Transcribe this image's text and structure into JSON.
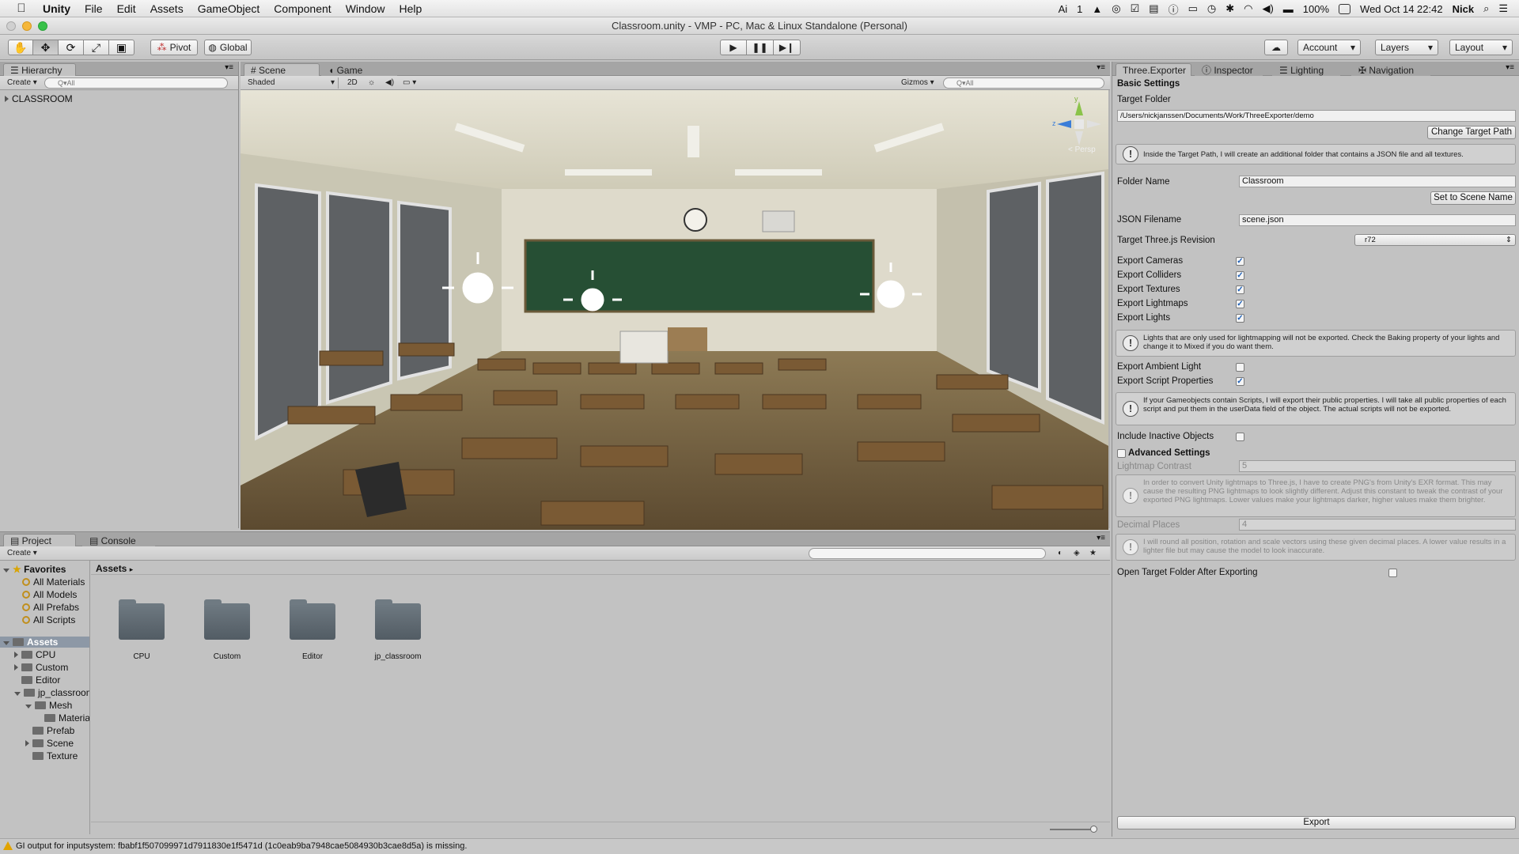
{
  "menubar": {
    "app_name": "Unity",
    "menus": [
      "File",
      "Edit",
      "Assets",
      "GameObject",
      "Component",
      "Window",
      "Help"
    ],
    "status": {
      "battery": "100%",
      "datetime": "Wed Oct 14  22:42",
      "user": "Nick",
      "notification_count": "1"
    }
  },
  "window": {
    "title": "Classroom.unity - VMP - PC, Mac & Linux Standalone (Personal)"
  },
  "toolbar": {
    "pivot_label": "Pivot",
    "global_label": "Global",
    "account_label": "Account",
    "layers_label": "Layers",
    "layout_label": "Layout"
  },
  "hierarchy": {
    "tab_label": "Hierarchy",
    "create_label": "Create",
    "search_placeholder": "Q▾All",
    "items": [
      "CLASSROOM"
    ]
  },
  "scene": {
    "tabs": [
      "Scene",
      "Game"
    ],
    "shading": "Shaded",
    "mode_2d": "2D",
    "gizmos_label": "Gizmos",
    "search_placeholder": "Q▾All",
    "persp_label": "Persp",
    "axis_labels": {
      "y": "y",
      "z": "z"
    }
  },
  "inspector": {
    "tabs": [
      "Three.Exporter",
      "Inspector",
      "Lighting",
      "Navigation"
    ],
    "basic_settings": "Basic Settings",
    "target_folder_label": "Target Folder",
    "target_folder_value": "/Users/nickjanssen/Documents/Work/ThreeExporter/demo",
    "change_target_path": "Change Target Path",
    "info_target_path": "Inside the Target Path, I will create an additional folder that contains a JSON file and all textures.",
    "folder_name_label": "Folder Name",
    "folder_name_value": "Classroom",
    "set_to_scene_name": "Set to Scene Name",
    "json_filename_label": "JSON Filename",
    "json_filename_value": "scene.json",
    "revision_label": "Target Three.js Revision",
    "revision_value": "r72",
    "options": [
      {
        "label": "Export Cameras",
        "checked": true
      },
      {
        "label": "Export Colliders",
        "checked": true
      },
      {
        "label": "Export Textures",
        "checked": true
      },
      {
        "label": "Export Lightmaps",
        "checked": true
      },
      {
        "label": "Export Lights",
        "checked": true
      }
    ],
    "info_lights": "Lights that are only used for lightmapping will not be exported. Check the Baking property of your lights and change it to Mixed if you do want them.",
    "export_ambient_label": "Export Ambient Light",
    "export_ambient_checked": false,
    "export_script_label": "Export Script Properties",
    "export_script_checked": true,
    "info_scripts": "If your Gameobjects contain Scripts, I will export their public properties. I will take all public properties of each script and put them in the userData field of the object. The actual scripts will not be exported.",
    "include_inactive_label": "Include Inactive Objects",
    "include_inactive_checked": false,
    "advanced_settings": "Advanced Settings",
    "lightmap_contrast_label": "Lightmap Contrast",
    "lightmap_contrast_value": "5",
    "info_lightmap": "In order to convert Unity lightmaps to Three.js, I have to create PNG's from Unity's EXR format. This may cause the resulting PNG lightmaps to look slightly different. Adjust this constant to tweak the contrast of your exported PNG lightmaps. Lower values make your lightmaps darker, higher values make them brighter.",
    "decimal_places_label": "Decimal Places",
    "decimal_places_value": "4",
    "info_decimal": "I will round all position, rotation and scale vectors using these given decimal places. A lower value results in a lighter file but may cause the model to look inaccurate.",
    "open_target_label": "Open Target Folder After Exporting",
    "open_target_checked": false,
    "export_button": "Export"
  },
  "project": {
    "tabs": [
      "Project",
      "Console"
    ],
    "create_label": "Create",
    "favorites_label": "Favorites",
    "favorites": [
      "All Materials",
      "All Models",
      "All Prefabs",
      "All Scripts"
    ],
    "assets_label": "Assets",
    "tree": [
      {
        "label": "CPU",
        "indent": 1,
        "fold": "closed"
      },
      {
        "label": "Custom",
        "indent": 1,
        "fold": "closed"
      },
      {
        "label": "Editor",
        "indent": 1,
        "fold": "none"
      },
      {
        "label": "jp_classroom",
        "indent": 1,
        "fold": "open"
      },
      {
        "label": "Mesh",
        "indent": 2,
        "fold": "open"
      },
      {
        "label": "Materia",
        "indent": 3,
        "fold": "none"
      },
      {
        "label": "Prefab",
        "indent": 2,
        "fold": "none"
      },
      {
        "label": "Scene",
        "indent": 2,
        "fold": "closed"
      },
      {
        "label": "Texture",
        "indent": 2,
        "fold": "none"
      }
    ],
    "breadcrumb": "Assets",
    "assets": [
      "CPU",
      "Custom",
      "Editor",
      "jp_classroom"
    ]
  },
  "status_bar": {
    "message": "GI output for inputsystem: fbabf1f507099971d7911830e1f5471d (1c0eab9ba7948cae5084930b3cae8d5a) is missing."
  }
}
